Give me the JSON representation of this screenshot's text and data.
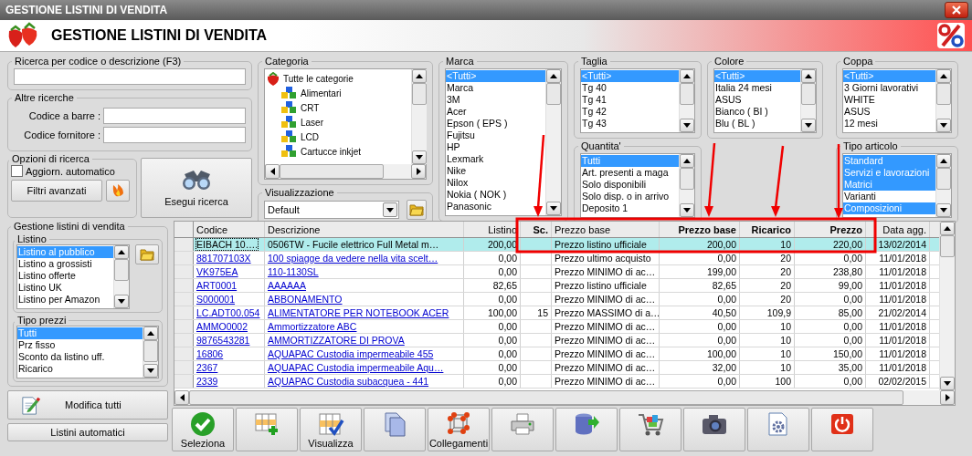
{
  "window": {
    "title": "GESTIONE LISTINI DI VENDITA"
  },
  "header": {
    "title": "GESTIONE LISTINI DI VENDITA"
  },
  "search": {
    "label": "Ricerca per codice o descrizione (F3)"
  },
  "other_searches": {
    "label": "Altre ricerche",
    "fields": [
      {
        "label": "Codice a barre :"
      },
      {
        "label": "Codice fornitore :"
      }
    ]
  },
  "search_options": {
    "label": "Opzioni di ricerca",
    "auto_update": {
      "label": "Aggiorn. automatico",
      "checked": false
    },
    "advanced_filters": "Filtri avanzati"
  },
  "run_search": "Esegui ricerca",
  "categoria": {
    "label": "Categoria",
    "tree": {
      "label": "Tutte le categorie",
      "children": [
        {
          "label": "Alimentari"
        },
        {
          "label": "CRT"
        },
        {
          "label": "Laser"
        },
        {
          "label": "LCD"
        },
        {
          "label": "Cartucce inkjet"
        }
      ]
    }
  },
  "visualizzazione": {
    "label": "Visualizzazione",
    "value": "Default"
  },
  "marca": {
    "label": "Marca",
    "items": [
      {
        "label": "<Tutti>",
        "selected": true
      },
      {
        "label": "Marca",
        "selected": false
      },
      {
        "label": "3M",
        "selected": false
      },
      {
        "label": "Acer",
        "selected": false
      },
      {
        "label": "Epson ( EPS )",
        "selected": false
      },
      {
        "label": "Fujitsu",
        "selected": false
      },
      {
        "label": "HP",
        "selected": false
      },
      {
        "label": "Lexmark",
        "selected": false
      },
      {
        "label": "Nike",
        "selected": false
      },
      {
        "label": "Nilox",
        "selected": false
      },
      {
        "label": "Nokia ( NOK )",
        "selected": false
      },
      {
        "label": "Panasonic",
        "selected": false
      }
    ]
  },
  "taglia": {
    "label": "Taglia",
    "items": [
      {
        "label": "<Tutti>",
        "selected": true
      },
      {
        "label": "Tg 40",
        "selected": false
      },
      {
        "label": "Tg 41",
        "selected": false
      },
      {
        "label": "Tg 42",
        "selected": false
      },
      {
        "label": "Tg 43",
        "selected": false
      }
    ]
  },
  "colore": {
    "label": "Colore",
    "items": [
      {
        "label": "<Tutti>",
        "selected": true
      },
      {
        "label": "Italia 24 mesi",
        "selected": false
      },
      {
        "label": "ASUS",
        "selected": false
      },
      {
        "label": "Bianco ( BI )",
        "selected": false
      },
      {
        "label": "Blu ( BL )",
        "selected": false
      }
    ]
  },
  "coppa": {
    "label": "Coppa",
    "items": [
      {
        "label": "<Tutti>",
        "selected": true
      },
      {
        "label": "3 Giorni lavorativi",
        "selected": false
      },
      {
        "label": "WHITE",
        "selected": false
      },
      {
        "label": "ASUS",
        "selected": false
      },
      {
        "label": "12 mesi",
        "selected": false
      }
    ]
  },
  "quantita": {
    "label": "Quantita'",
    "items": [
      {
        "label": "Tutti",
        "selected": true
      },
      {
        "label": "Art. presenti a maga",
        "selected": false
      },
      {
        "label": "Solo disponibili",
        "selected": false
      },
      {
        "label": "Solo disp. o in arrivo",
        "selected": false
      },
      {
        "label": "Deposito 1",
        "selected": false
      }
    ]
  },
  "tipo_articolo": {
    "label": "Tipo articolo",
    "items": [
      {
        "label": "Standard",
        "selected": true
      },
      {
        "label": "Servizi e lavorazioni",
        "selected": true
      },
      {
        "label": "Matrici",
        "selected": true
      },
      {
        "label": "Varianti",
        "selected": false
      },
      {
        "label": "Composizioni",
        "selected": true
      }
    ]
  },
  "price_lists": {
    "label": "Gestione listini di vendita",
    "listino": {
      "label": "Listino",
      "items": [
        {
          "label": "Listino al pubblico",
          "selected": true
        },
        {
          "label": "Listino a grossisti",
          "selected": false
        },
        {
          "label": "Listino offerte",
          "selected": false
        },
        {
          "label": "Listino UK",
          "selected": false
        },
        {
          "label": "Listino per Amazon",
          "selected": false
        }
      ]
    },
    "tipo_prezzi": {
      "label": "Tipo prezzi",
      "items": [
        {
          "label": "Tutti",
          "selected": true
        },
        {
          "label": "Prz fisso",
          "selected": false
        },
        {
          "label": "Sconto da listino uff.",
          "selected": false
        },
        {
          "label": "Ricarico",
          "selected": false
        }
      ]
    },
    "edit_all": "Modifica tutti",
    "auto_lists": "Listini automatici"
  },
  "table": {
    "columns": [
      {
        "label": "Codice",
        "kind": "link",
        "bold": false
      },
      {
        "label": "Descrizione",
        "kind": "link",
        "bold": false
      },
      {
        "label": "Listino",
        "kind": "number",
        "bold": false
      },
      {
        "label": "Sc.",
        "kind": "number",
        "bold": true
      },
      {
        "label": "Prezzo base",
        "kind": "text",
        "bold": false
      },
      {
        "label": "Prezzo base",
        "kind": "number",
        "bold": true
      },
      {
        "label": "Ricarico",
        "kind": "number",
        "bold": true
      },
      {
        "label": "Prezzo",
        "kind": "number",
        "bold": true
      },
      {
        "label": "Data agg.",
        "kind": "number",
        "bold": false
      }
    ],
    "rows": [
      {
        "selected": true,
        "cells": [
          "EIBACH  10….",
          "0506TW  - Fucile elettrico Full Metal m…",
          "200,00",
          "",
          "Prezzo listino ufficiale",
          "200,00",
          "10",
          "220,00",
          "13/02/2014"
        ]
      },
      {
        "selected": false,
        "cells": [
          "881707103X",
          "100 spiagge da vedere nella vita scelt…",
          "0,00",
          "",
          "Prezzo ultimo acquisto",
          "0,00",
          "20",
          "0,00",
          "11/01/2018"
        ]
      },
      {
        "selected": false,
        "cells": [
          "VK975EA",
          "110-1130SL",
          "0,00",
          "",
          "Prezzo MINIMO di ac…",
          "199,00",
          "20",
          "238,80",
          "11/01/2018"
        ]
      },
      {
        "selected": false,
        "cells": [
          "ART0001",
          "AAAAAA",
          "82,65",
          "",
          "Prezzo listino ufficiale",
          "82,65",
          "20",
          "99,00",
          "11/01/2018"
        ]
      },
      {
        "selected": false,
        "cells": [
          "S000001",
          "ABBONAMENTO",
          "0,00",
          "",
          "Prezzo MINIMO di ac…",
          "0,00",
          "20",
          "0,00",
          "11/01/2018"
        ]
      },
      {
        "selected": false,
        "cells": [
          "LC.ADT00.054",
          "ALIMENTATORE PER NOTEBOOK ACER",
          "100,00",
          "15",
          "Prezzo MASSIMO di a…",
          "40,50",
          "109,9",
          "85,00",
          "21/02/2014"
        ]
      },
      {
        "selected": false,
        "cells": [
          "AMMO0002",
          "Ammortizzatore ABC",
          "0,00",
          "",
          "Prezzo MINIMO di ac…",
          "0,00",
          "10",
          "0,00",
          "11/01/2018"
        ]
      },
      {
        "selected": false,
        "cells": [
          "9876543281",
          "AMMORTIZZATORE DI PROVA",
          "0,00",
          "",
          "Prezzo MINIMO di ac…",
          "0,00",
          "10",
          "0,00",
          "11/01/2018"
        ]
      },
      {
        "selected": false,
        "cells": [
          "16806",
          "AQUAPAC Custodia impermeabile 455",
          "0,00",
          "",
          "Prezzo MINIMO di ac…",
          "100,00",
          "10",
          "150,00",
          "11/01/2018"
        ]
      },
      {
        "selected": false,
        "cells": [
          "2367",
          "AQUAPAC Custodia impermeabile Aqu…",
          "0,00",
          "",
          "Prezzo MINIMO di ac…",
          "32,00",
          "10",
          "35,00",
          "11/01/2018"
        ]
      },
      {
        "selected": false,
        "cells": [
          "2339",
          "AQUAPAC Custodia subacquea - 441",
          "0,00",
          "",
          "Prezzo MINIMO di ac…",
          "0,00",
          "100",
          "0,00",
          "02/02/2015"
        ]
      }
    ]
  },
  "toolbar": {
    "select": "Seleziona",
    "view": "Visualizza",
    "links": "Collegamenti"
  }
}
